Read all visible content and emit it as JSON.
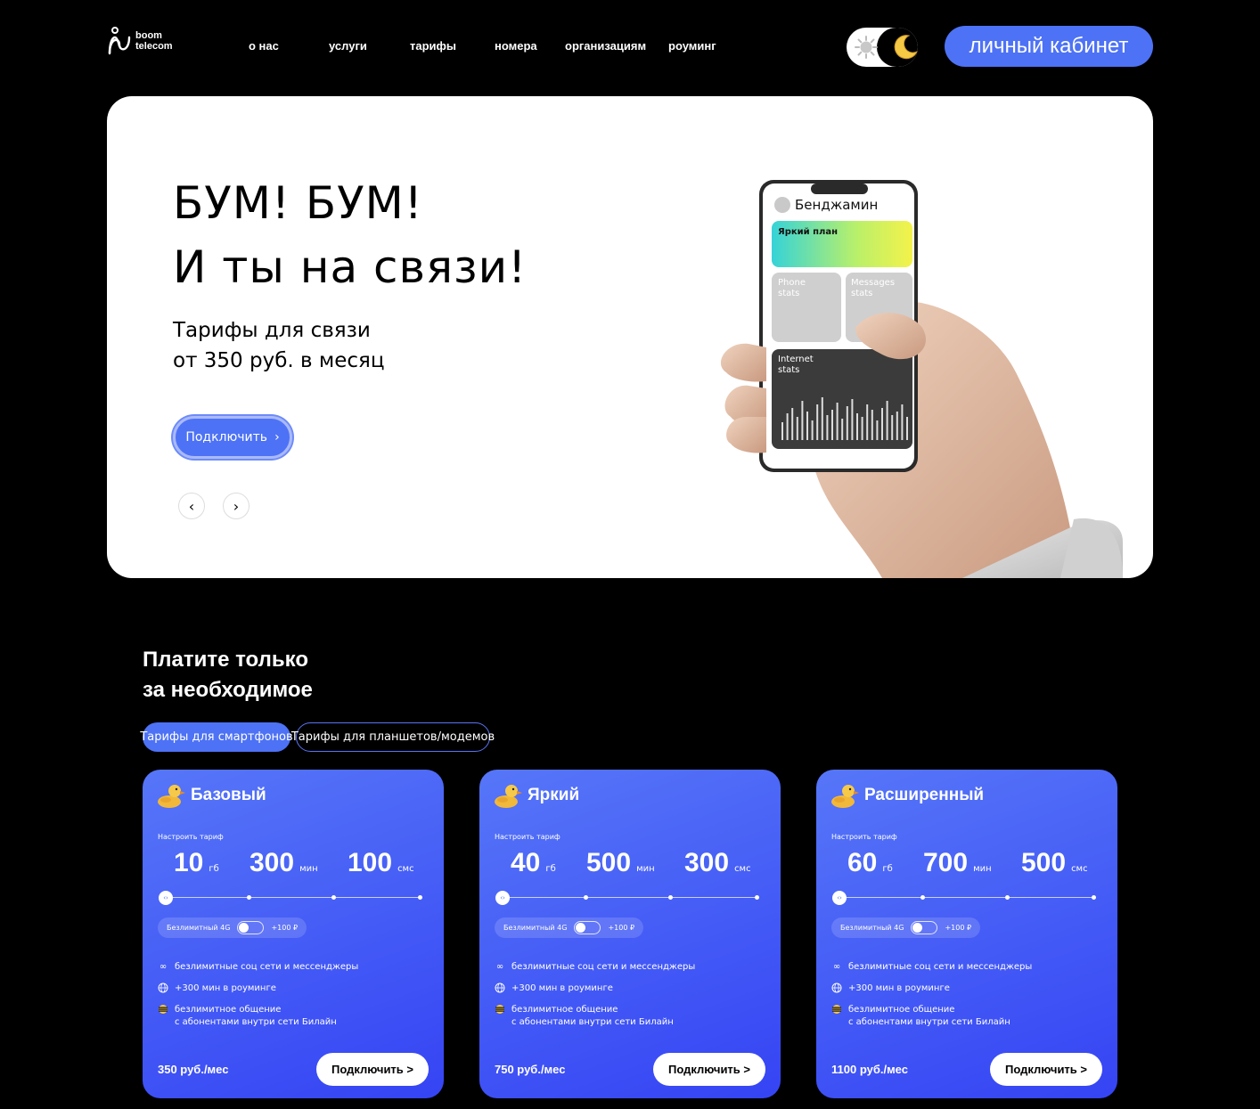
{
  "header": {
    "logo_line1": "boom",
    "logo_line2": "telecom",
    "nav": [
      "о нас",
      "услуги",
      "тарифы",
      "номера",
      "организациям",
      "роуминг"
    ],
    "cabinet_label": "личный кабинет",
    "accent": "#4d72f5"
  },
  "hero": {
    "title_line1": "БУМ! БУМ!",
    "title_line2": "И ты на связи!",
    "sub_line1": "Тарифы для связи",
    "sub_line2": "от 350 руб. в месяц",
    "cta_label": "Подключить",
    "phone": {
      "user_name": "Бенджамин",
      "plan_label": "Яркий план",
      "phone_stats": "Phone\nstats",
      "messages_stats": "Messages\nstats",
      "internet_stats": "Internet\nstats"
    }
  },
  "section": {
    "title_line1": "Платите только",
    "title_line2": "за необходимое",
    "tabs": [
      "Тарифы для смартфонов",
      "Тарифы для планшетов/модемов"
    ]
  },
  "cards": [
    {
      "name": "Базовый",
      "configure_label": "Настроить тариф",
      "gb": "10",
      "gb_unit": "гб",
      "min": "300",
      "min_unit": "мин",
      "sms": "100",
      "sms_unit": "смс",
      "unlim_label": "Безлимитный 4G",
      "unlim_price": "+100 ₽",
      "features": [
        "безлимитные соц сети и мессенджеры",
        "+300 мин в роуминге",
        "безлимитное общение\nс абонентами внутри сети Билайн"
      ],
      "price": "350 руб./мес",
      "button": "Подключить >"
    },
    {
      "name": "Яркий",
      "configure_label": "Настроить тариф",
      "gb": "40",
      "gb_unit": "гб",
      "min": "500",
      "min_unit": "мин",
      "sms": "300",
      "sms_unit": "смс",
      "unlim_label": "Безлимитный 4G",
      "unlim_price": "+100 ₽",
      "features": [
        "безлимитные соц сети и мессенджеры",
        "+300 мин в роуминге",
        "безлимитное общение\nс абонентами внутри сети Билайн"
      ],
      "price": "750 руб./мес",
      "button": "Подключить >"
    },
    {
      "name": "Расширенный",
      "configure_label": "Настроить тариф",
      "gb": "60",
      "gb_unit": "гб",
      "min": "700",
      "min_unit": "мин",
      "sms": "500",
      "sms_unit": "смс",
      "unlim_label": "Безлимитный 4G",
      "unlim_price": "+100 ₽",
      "features": [
        "безлимитные соц сети и мессенджеры",
        "+300 мин в роуминге",
        "безлимитное общение\nс абонентами внутри сети Билайн"
      ],
      "price": "1100 руб./мес",
      "button": "Подключить >"
    }
  ],
  "icons": {
    "feature_icons": [
      "infinity-icon",
      "globe-icon",
      "beeline-icon"
    ]
  }
}
